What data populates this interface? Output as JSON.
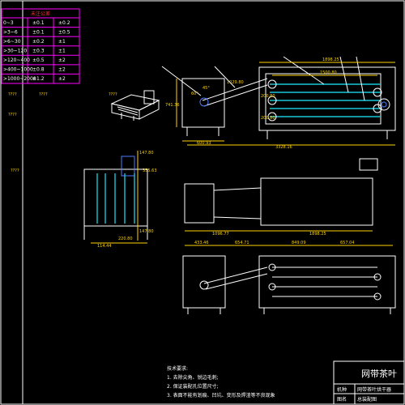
{
  "tolerance_table": {
    "header": "未注公差",
    "rows": [
      {
        "range": "0~3",
        "tol": "±0.1",
        "tol2": "±0.2"
      },
      {
        "range": ">3~6",
        "tol": "±0.1",
        "tol2": "±0.5"
      },
      {
        "range": ">6~30",
        "tol": "±0.2",
        "tol2": "±1"
      },
      {
        "range": ">30~120",
        "tol": "±0.3",
        "tol2": "±1"
      },
      {
        "range": ">120~400",
        "tol": "±0.5",
        "tol2": "±2"
      },
      {
        "range": ">400~1000",
        "tol": "±0.8",
        "tol2": "±2"
      },
      {
        "range": ">1000~2000",
        "tol": "±1.2",
        "tol2": "±2"
      }
    ]
  },
  "unknown_labels": [
    "????",
    "????",
    "????",
    "????",
    "????"
  ],
  "dims_top": {
    "d1": "1898.25",
    "d2": "1500.80",
    "d3": "1029.80",
    "d4": "741.36",
    "d5": "600.93",
    "d6": "3328.16",
    "d7": "200.80",
    "d8": "200.80",
    "angle1": "45°",
    "angle2": "60°"
  },
  "dims_side": {
    "d1": "147.80",
    "d2": "355.63",
    "d3": "147.80",
    "d4": "220.80",
    "d5": "114.44"
  },
  "dims_mid": {
    "d1": "1096.77",
    "d2": "1898.25"
  },
  "dims_bottom": {
    "d1": "433.46",
    "d2": "654.71",
    "d3": "849.09",
    "d4": "657.04"
  },
  "tech_notes": {
    "title": "技术要求:",
    "items": [
      "1. 去除尖角、锐边毛刺;",
      "2. 保证装配孔位置尺寸;",
      "3. 表面不能有划痕、凹坑、变形及焊渣等不良现象"
    ]
  },
  "title_block": {
    "title": "网带茶叶",
    "label_type": "机种",
    "label_name": "网带茶叶烘干器",
    "label_drawing": "图名",
    "drawing_name": "总装配图"
  },
  "colors": {
    "line": "#ffffff",
    "dimension": "#ffd200",
    "belt": "#19c6d8",
    "accent": "#4f7bff",
    "table_text": "#ff3030",
    "table_frame": "#ff00ff"
  }
}
